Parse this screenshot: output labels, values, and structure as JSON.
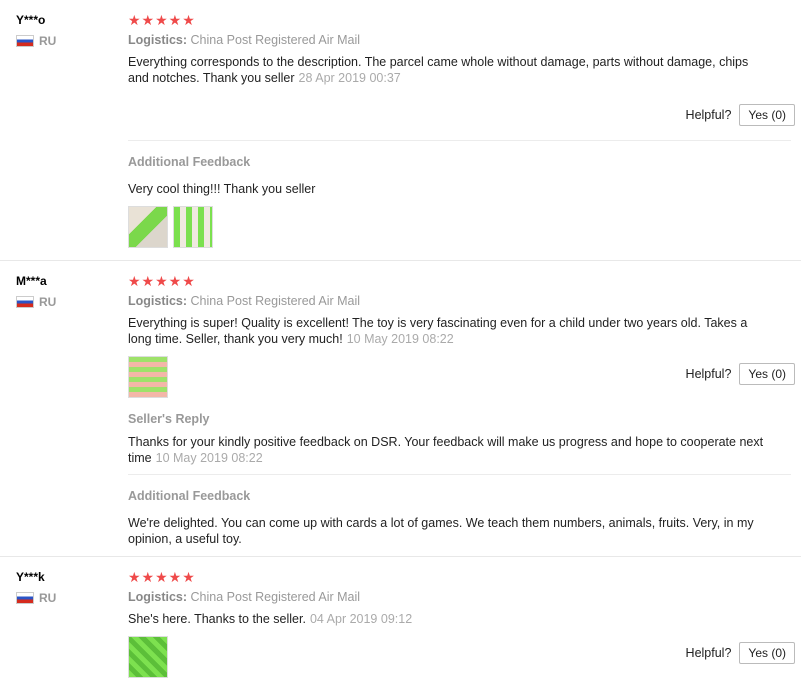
{
  "reviews": [
    {
      "user": "Y***o",
      "country": "RU",
      "stars": "★★★★★",
      "logistics_label": "Logistics:",
      "logistics_value": "China Post Registered Air Mail",
      "text": "Everything corresponds to the description. The parcel came whole without damage, parts without damage, chips and notches. Thank you seller",
      "date": "28 Apr 2019 00:37",
      "helpful_label": "Helpful?",
      "yes_label": "Yes (0)",
      "additional_title": "Additional Feedback",
      "additional_text": "Very cool thing!!! Thank you seller"
    },
    {
      "user": "M***a",
      "country": "RU",
      "stars": "★★★★★",
      "logistics_label": "Logistics:",
      "logistics_value": "China Post Registered Air Mail",
      "text": "Everything is super! Quality is excellent! The toy is very fascinating even for a child under two years old. Takes a long time. Seller, thank you very much!",
      "date": "10 May 2019 08:22",
      "helpful_label": "Helpful?",
      "yes_label": "Yes (0)",
      "reply_title": "Seller's Reply",
      "reply_text": "Thanks for your kindly positive feedback on DSR. Your feedback will make us progress and hope to cooperate next time",
      "reply_date": "10 May 2019 08:22",
      "additional_title": "Additional Feedback",
      "additional_text": "We're delighted. You can come up with cards a lot of games. We teach them numbers, animals, fruits. Very, in my opinion, a useful toy."
    },
    {
      "user": "Y***k",
      "country": "RU",
      "stars": "★★★★★",
      "logistics_label": "Logistics:",
      "logistics_value": "China Post Registered Air Mail",
      "text": "She's here. Thanks to the seller.",
      "date": "04 Apr 2019 09:12",
      "helpful_label": "Helpful?",
      "yes_label": "Yes (0)"
    }
  ]
}
